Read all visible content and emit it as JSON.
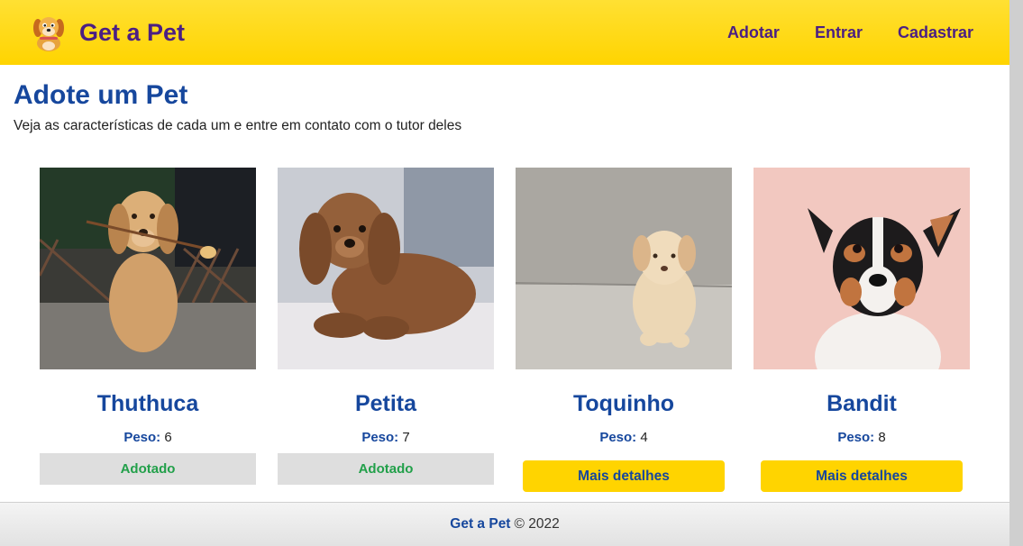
{
  "navbar": {
    "brand": "Get a Pet",
    "logo_icon": "dog-logo-icon",
    "links": [
      "Adotar",
      "Entrar",
      "Cadastrar"
    ]
  },
  "page": {
    "title": "Adote um Pet",
    "subtitle": "Veja as características de cada um e entre em contato com o tutor deles"
  },
  "weight_label": "Peso:",
  "pets": [
    {
      "name": "Thuthuca",
      "weight": "6",
      "status": "Adotado",
      "photo": "golden-retriever-puppy-with-flower"
    },
    {
      "name": "Petita",
      "weight": "7",
      "status": "Adotado",
      "photo": "brown-cavapoo-on-bed"
    },
    {
      "name": "Toquinho",
      "weight": "4",
      "action": "Mais detalhes",
      "photo": "cream-labrador-puppy"
    },
    {
      "name": "Bandit",
      "weight": "8",
      "action": "Mais detalhes",
      "photo": "jack-russell-terrier"
    }
  ],
  "footer": {
    "brand": "Get a Pet",
    "copyright": "© 2022"
  },
  "colors": {
    "nav_yellow": "#ffd400",
    "brand_purple": "#4b1f83",
    "title_blue": "#16479d",
    "adopted_green": "#22a04a"
  }
}
